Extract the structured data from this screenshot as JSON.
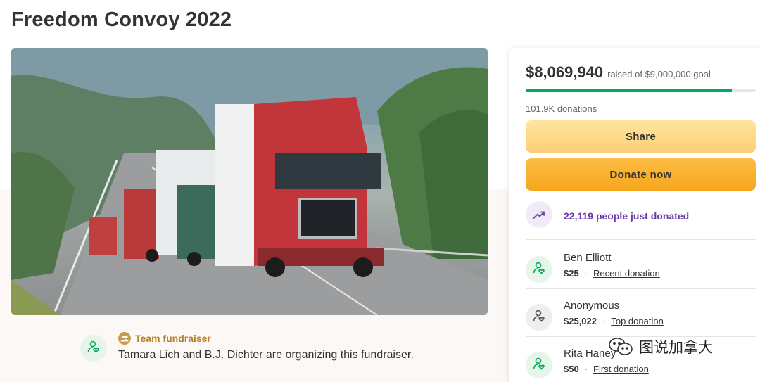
{
  "page": {
    "title": "Freedom Convoy 2022"
  },
  "organizer": {
    "badge": "Team fundraiser",
    "text": "Tamara Lich and B.J. Dichter are organizing this fundraiser."
  },
  "sidebar": {
    "amount_raised": "$8,069,940",
    "goal_text": "raised of $9,000,000 goal",
    "progress_fraction": 0.8967,
    "donations_count": "101.9K donations",
    "share_label": "Share",
    "donate_label": "Donate now",
    "recent_activity": "22,119 people just donated",
    "donors": [
      {
        "name": "Ben Elliott",
        "amount": "$25",
        "tag": "Recent donation"
      },
      {
        "name": "Anonymous",
        "amount": "$25,022",
        "tag": "Top donation"
      },
      {
        "name": "Rita Haney",
        "amount": "$50",
        "tag": "First donation"
      }
    ]
  },
  "watermark": {
    "text": "图说加拿大"
  },
  "colors": {
    "progress": "#02a95c",
    "purple": "#6b3aa8",
    "donate_orange": "#f6a51c",
    "share_yellow": "#fdcf76",
    "team_gold": "#b5832a"
  },
  "icons": {
    "organizer": "person-heart-icon",
    "team": "team-icon",
    "recent": "trending-up-icon",
    "donor": "person-heart-icon",
    "watermark": "wechat-icon"
  }
}
